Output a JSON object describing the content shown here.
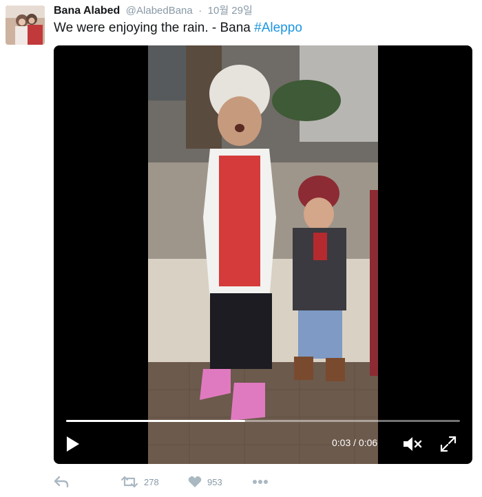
{
  "tweet": {
    "author_name": "Bana Alabed",
    "handle": "@AlabedBana",
    "separator": "·",
    "time": "10월 29일",
    "text": "We were enjoying the rain. - Bana ",
    "hashtag": "#Aleppo"
  },
  "video": {
    "current_time": "0:03",
    "time_separator": " / ",
    "duration": "0:06",
    "progress_fraction": 0.455,
    "muted": true,
    "play_icon": "play-icon",
    "mute_icon": "speaker-muted-icon",
    "fullscreen_icon": "fullscreen-icon"
  },
  "actions": {
    "reply_icon": "reply-icon",
    "retweet_icon": "retweet-icon",
    "retweet_count": "278",
    "like_icon": "heart-icon",
    "like_count": "953",
    "more_icon": "more-icon"
  },
  "colors": {
    "hashtag": "#1b95e0",
    "muted_text": "#8899a6",
    "action_icon": "#aab8c2"
  }
}
